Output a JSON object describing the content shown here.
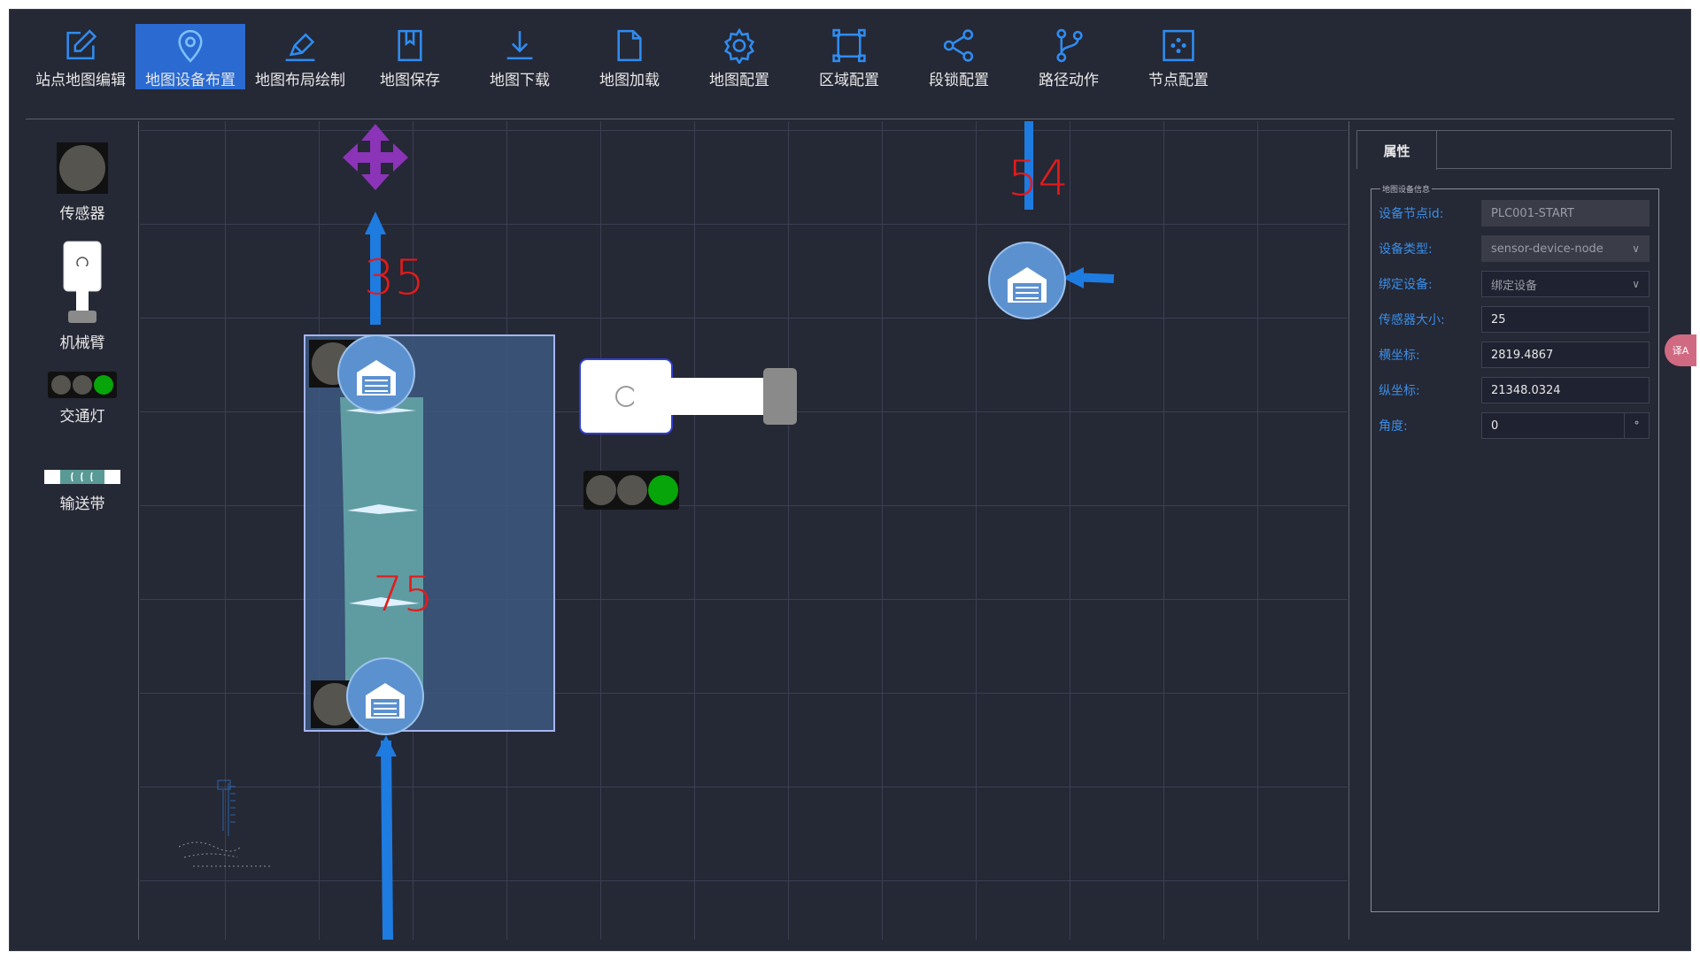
{
  "toolbar": {
    "items": [
      {
        "label": "站点地图编辑",
        "icon": "edit-icon"
      },
      {
        "label": "地图设备布置",
        "icon": "location-pin-icon",
        "active": true
      },
      {
        "label": "地图布局绘制",
        "icon": "brush-icon"
      },
      {
        "label": "地图保存",
        "icon": "bookmark-icon"
      },
      {
        "label": "地图下载",
        "icon": "download-icon"
      },
      {
        "label": "地图加载",
        "icon": "file-icon"
      },
      {
        "label": "地图配置",
        "icon": "gear-icon"
      },
      {
        "label": "区域配置",
        "icon": "area-select-icon"
      },
      {
        "label": "段锁配置",
        "icon": "share-nodes-icon"
      },
      {
        "label": "路径动作",
        "icon": "branch-icon"
      },
      {
        "label": "节点配置",
        "icon": "grid-dots-icon"
      }
    ],
    "accent_color": "#2a6ad1",
    "icon_color": "#2f8cf0"
  },
  "palette": {
    "items": [
      {
        "label": "传感器",
        "icon": "sensor-icon"
      },
      {
        "label": "机械臂",
        "icon": "robot-arm-icon"
      },
      {
        "label": "交通灯",
        "icon": "traffic-light-icon"
      },
      {
        "label": "输送带",
        "icon": "conveyor-icon"
      }
    ]
  },
  "canvas": {
    "node_labels": {
      "n35": "35",
      "n54": "54",
      "n75": "75"
    },
    "label_color": "#e31b1b",
    "path_color": "#1e7be0",
    "selection_color": "#a6b4ef",
    "traffic_light_color": "#07a50a"
  },
  "properties": {
    "tab": "属性",
    "group": "地图设备信息",
    "fields": {
      "node_id": {
        "label": "设备节点id:",
        "value": "PLC001-START"
      },
      "device_type": {
        "label": "设备类型:",
        "value": "sensor-device-node"
      },
      "bind_device": {
        "label": "绑定设备:",
        "value": "绑定设备"
      },
      "sensor_size": {
        "label": "传感器大小:",
        "value": "25"
      },
      "x_coord": {
        "label": "横坐标:",
        "value": "2819.4867"
      },
      "y_coord": {
        "label": "纵坐标:",
        "value": "21348.0324"
      },
      "angle": {
        "label": "角度:",
        "value": "0",
        "unit": "°"
      }
    }
  },
  "translate_button": {
    "label": "译A"
  }
}
